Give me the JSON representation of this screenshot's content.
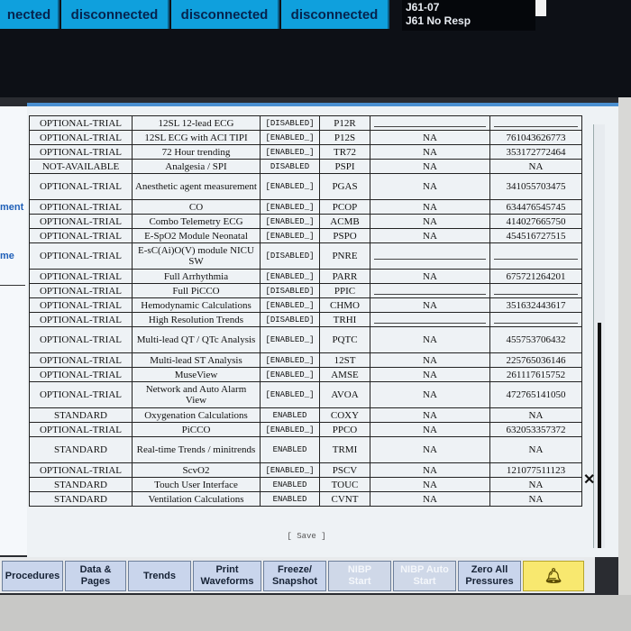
{
  "status_tabs": [
    {
      "label": "nected"
    },
    {
      "label": "disconnected"
    },
    {
      "label": "disconnected"
    },
    {
      "label": "disconnected"
    }
  ],
  "info_box": {
    "line1": "J61-07",
    "line2": "J61 No Resp"
  },
  "side_labels": {
    "a": "ment",
    "b": "me"
  },
  "table": {
    "rows": [
      {
        "type": "OPTIONAL-TRIAL",
        "feature": "12SL 12-lead ECG",
        "state": "[DISABLED]",
        "code": "P12R",
        "support": "",
        "key": ""
      },
      {
        "type": "OPTIONAL-TRIAL",
        "feature": "12SL ECG with ACI TIPI",
        "state": "[ENABLED_]",
        "code": "P12S",
        "support": "NA",
        "key": "761043626773"
      },
      {
        "type": "OPTIONAL-TRIAL",
        "feature": "72 Hour trending",
        "state": "[ENABLED_]",
        "code": "TR72",
        "support": "NA",
        "key": "353172772464"
      },
      {
        "type": "NOT-AVAILABLE",
        "feature": "Analgesia / SPI",
        "state": "DISABLED",
        "code": "PSPI",
        "support": "NA",
        "key": "NA"
      },
      {
        "type": "OPTIONAL-TRIAL",
        "feature": "Anesthetic agent measurement",
        "state": "[ENABLED_]",
        "code": "PGAS",
        "support": "NA",
        "key": "341055703475"
      },
      {
        "type": "OPTIONAL-TRIAL",
        "feature": "CO",
        "state": "[ENABLED_]",
        "code": "PCOP",
        "support": "NA",
        "key": "634476545745"
      },
      {
        "type": "OPTIONAL-TRIAL",
        "feature": "Combo Telemetry ECG",
        "state": "[ENABLED_]",
        "code": "ACMB",
        "support": "NA",
        "key": "414027665750"
      },
      {
        "type": "OPTIONAL-TRIAL",
        "feature": "E-SpO2 Module Neonatal",
        "state": "[ENABLED_]",
        "code": "PSPO",
        "support": "NA",
        "key": "454516727515"
      },
      {
        "type": "OPTIONAL-TRIAL",
        "feature": "E-sC(Ai)O(V) module NICU SW",
        "state": "[DISABLED]",
        "code": "PNRE",
        "support": "",
        "key": ""
      },
      {
        "type": "OPTIONAL-TRIAL",
        "feature": "Full Arrhythmia",
        "state": "[ENABLED_]",
        "code": "PARR",
        "support": "NA",
        "key": "675721264201"
      },
      {
        "type": "OPTIONAL-TRIAL",
        "feature": "Full PiCCO",
        "state": "[DISABLED]",
        "code": "PPIC",
        "support": "",
        "key": ""
      },
      {
        "type": "OPTIONAL-TRIAL",
        "feature": "Hemodynamic Calculations",
        "state": "[ENABLED_]",
        "code": "CHMO",
        "support": "NA",
        "key": "351632443617"
      },
      {
        "type": "OPTIONAL-TRIAL",
        "feature": "High Resolution Trends",
        "state": "[DISABLED]",
        "code": "TRHI",
        "support": "",
        "key": ""
      },
      {
        "type": "OPTIONAL-TRIAL",
        "feature": "Multi-lead QT / QTc Analysis",
        "state": "[ENABLED_]",
        "code": "PQTC",
        "support": "NA",
        "key": "455753706432"
      },
      {
        "type": "OPTIONAL-TRIAL",
        "feature": "Multi-lead ST Analysis",
        "state": "[ENABLED_]",
        "code": "12ST",
        "support": "NA",
        "key": "225765036146"
      },
      {
        "type": "OPTIONAL-TRIAL",
        "feature": "MuseView",
        "state": "[ENABLED_]",
        "code": "AMSE",
        "support": "NA",
        "key": "261117615752"
      },
      {
        "type": "OPTIONAL-TRIAL",
        "feature": "Network and Auto Alarm View",
        "state": "[ENABLED_]",
        "code": "AVOA",
        "support": "NA",
        "key": "472765141050"
      },
      {
        "type": "STANDARD",
        "feature": "Oxygenation Calculations",
        "state": "ENABLED",
        "code": "COXY",
        "support": "NA",
        "key": "NA"
      },
      {
        "type": "OPTIONAL-TRIAL",
        "feature": "PiCCO",
        "state": "[ENABLED_]",
        "code": "PPCO",
        "support": "NA",
        "key": "632053357372"
      },
      {
        "type": "STANDARD",
        "feature": "Real-time Trends / minitrends",
        "state": "ENABLED",
        "code": "TRMI",
        "support": "NA",
        "key": "NA"
      },
      {
        "type": "OPTIONAL-TRIAL",
        "feature": "ScvO2",
        "state": "[ENABLED_]",
        "code": "PSCV",
        "support": "NA",
        "key": "121077511123"
      },
      {
        "type": "STANDARD",
        "feature": "Touch User Interface",
        "state": "ENABLED",
        "code": "TOUC",
        "support": "NA",
        "key": "NA"
      },
      {
        "type": "STANDARD",
        "feature": "Ventilation Calculations",
        "state": "ENABLED",
        "code": "CVNT",
        "support": "NA",
        "key": "NA"
      }
    ]
  },
  "save_label": "[ Save ]",
  "close_label": "✕",
  "softkeys": [
    {
      "label": "Procedures",
      "disabled": false
    },
    {
      "label": "Data &\nPages",
      "disabled": false
    },
    {
      "label": "Trends",
      "disabled": false
    },
    {
      "label": "Print\nWaveforms",
      "disabled": false
    },
    {
      "label": "Freeze/\nSnapshot",
      "disabled": false
    },
    {
      "label": "NIBP\nStart",
      "disabled": true
    },
    {
      "label": "NIBP Auto\nStart",
      "disabled": true
    },
    {
      "label": "Zero All\nPressures",
      "disabled": false
    }
  ],
  "alarm_icon": "bell-icon",
  "colors": {
    "status_tab": "#0fa0dd",
    "softkey": "#c9d5ec",
    "alarm_key": "#f8e86f",
    "panel_border": "#4a8fd0"
  }
}
